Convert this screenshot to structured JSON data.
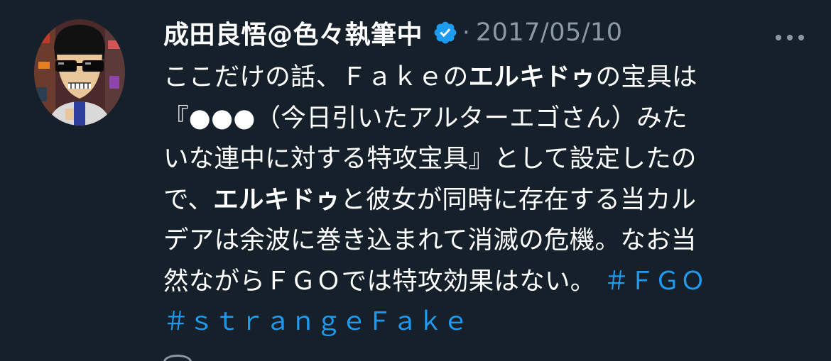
{
  "tweet": {
    "author_name": "成田良悟@色々執筆中",
    "verified_icon": "verified-badge-icon",
    "separator": "·",
    "date": "2017/05/10",
    "more_icon": "more-options-icon",
    "avatar_icon": "pixel-art-avatar-sunglasses-man",
    "text": {
      "l1a": "ここだけの話、Ｆａｋｅの",
      "l1b": "エルキドゥ",
      "l1c": "の宝具は",
      "l2": "『●●●（今日引いたアルターエゴさん）みた",
      "l3": "いな連中に対する特攻宝具』として設定したの",
      "l4a": "で、",
      "l4b": "エルキドゥ",
      "l4c": "と彼女が同時に存在する当カル",
      "l5": "デアは余波に巻き込まれて消滅の危機。なお当",
      "l6a": "然ながらＦＧＯでは特攻効果はない。",
      "hashtag1": "＃ＦＧＯ",
      "hashtag2": "＃ｓｔｒａｎｇｅＦａｋｅ"
    }
  },
  "colors": {
    "background": "#15202b",
    "text": "#ffffff",
    "secondary": "#8b98a5",
    "accent": "#1d9bf0"
  }
}
